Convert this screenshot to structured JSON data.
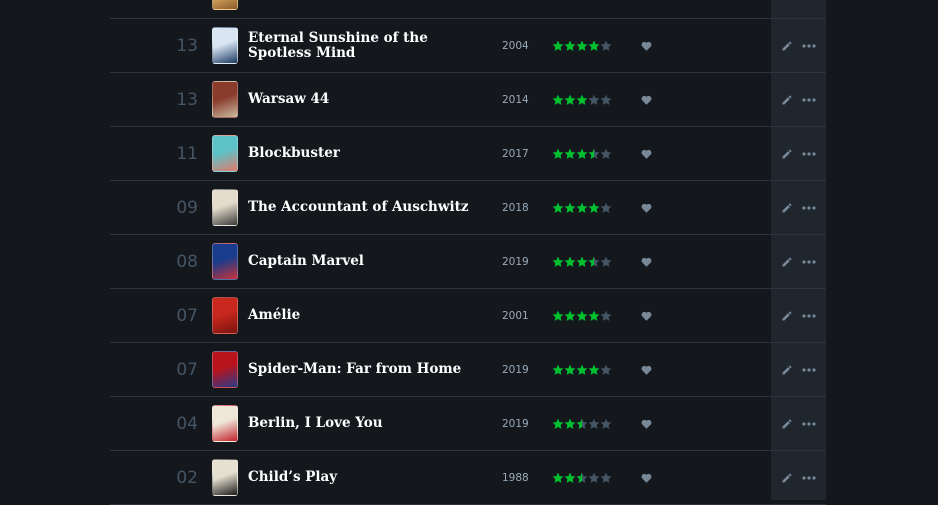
{
  "colors": {
    "background": "#14181c",
    "actions_column": "#1f262d",
    "row_divider": "#2c3440",
    "day_number": "#445566",
    "title": "#ffffff",
    "year": "#99aabb",
    "star_on": "#00c030",
    "star_off": "#445566",
    "icon": "#778899"
  },
  "icons": {
    "star": "star-icon",
    "half_star": "half-star-icon",
    "like": "heart-icon",
    "edit": "pencil-icon",
    "more": "ellipsis-icon"
  },
  "diary": {
    "entries": [
      {
        "day": "",
        "title": "",
        "year": "",
        "rating": 0,
        "poster_colors": [
          "#e8b86a",
          "#8a5a2a"
        ]
      },
      {
        "day": "13",
        "title": "Eternal Sunshine of the Spotless Mind",
        "year": "2004",
        "rating": 4,
        "poster_colors": [
          "#d9e6f2",
          "#1c3a63"
        ]
      },
      {
        "day": "13",
        "title": "Warsaw 44",
        "year": "2014",
        "rating": 3,
        "poster_colors": [
          "#8a3b2c",
          "#c9b9a0"
        ]
      },
      {
        "day": "11",
        "title": "Blockbuster",
        "year": "2017",
        "rating": 3.5,
        "poster_colors": [
          "#5ec2c8",
          "#e07a6a"
        ]
      },
      {
        "day": "09",
        "title": "The Accountant of Auschwitz",
        "year": "2018",
        "rating": 4,
        "poster_colors": [
          "#e3dccb",
          "#3a3a3a"
        ]
      },
      {
        "day": "08",
        "title": "Captain Marvel",
        "year": "2019",
        "rating": 3.5,
        "poster_colors": [
          "#1a3c8c",
          "#c8323a"
        ]
      },
      {
        "day": "07",
        "title": "Amélie",
        "year": "2001",
        "rating": 4,
        "poster_colors": [
          "#c8281e",
          "#7a1410"
        ]
      },
      {
        "day": "07",
        "title": "Spider-Man: Far from Home",
        "year": "2019",
        "rating": 4,
        "poster_colors": [
          "#b8141c",
          "#2a3a8a"
        ]
      },
      {
        "day": "04",
        "title": "Berlin, I Love You",
        "year": "2019",
        "rating": 2.5,
        "poster_colors": [
          "#efe7d8",
          "#c0202a"
        ]
      },
      {
        "day": "02",
        "title": "Child’s Play",
        "year": "1988",
        "rating": 2.5,
        "poster_colors": [
          "#e6e0d0",
          "#1a1a1a"
        ]
      }
    ]
  }
}
